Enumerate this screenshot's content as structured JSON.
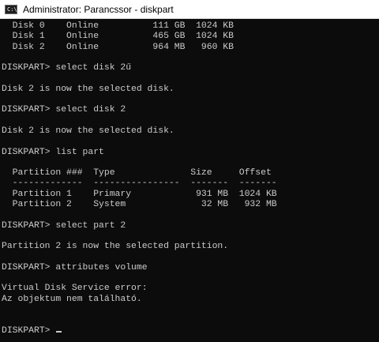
{
  "window": {
    "icon_text": "C:\\",
    "title": "Administrator: Parancssor - diskpart"
  },
  "console": {
    "lines": [
      "  Disk 0    Online          111 GB  1024 KB",
      "  Disk 1    Online          465 GB  1024 KB",
      "  Disk 2    Online          964 MB   960 KB",
      "",
      "DISKPART> select disk 2ű",
      "",
      "Disk 2 is now the selected disk.",
      "",
      "DISKPART> select disk 2",
      "",
      "Disk 2 is now the selected disk.",
      "",
      "DISKPART> list part",
      "",
      "  Partition ###  Type              Size     Offset",
      "  -------------  ----------------  -------  -------",
      "  Partition 1    Primary            931 MB  1024 KB",
      "  Partition 2    System              32 MB   932 MB",
      "",
      "DISKPART> select part 2",
      "",
      "Partition 2 is now the selected partition.",
      "",
      "DISKPART> attributes volume",
      "",
      "Virtual Disk Service error:",
      "Az objektum nem található.",
      "",
      ""
    ],
    "prompt": "DISKPART> "
  }
}
